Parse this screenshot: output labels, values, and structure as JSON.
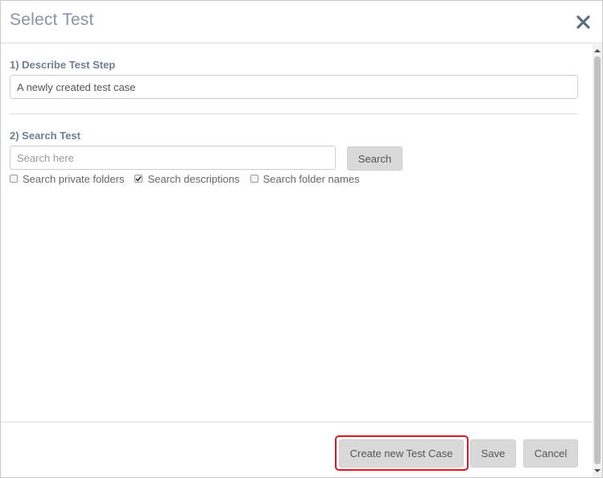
{
  "dialog": {
    "title": "Select Test",
    "close_icon": "close-x-icon"
  },
  "step1": {
    "label": "1) Describe Test Step",
    "value": "A newly created test case"
  },
  "step2": {
    "label": "2) Search Test",
    "search_placeholder": "Search here",
    "search_button": "Search",
    "options": [
      {
        "label": "Search private folders",
        "checked": false
      },
      {
        "label": "Search descriptions",
        "checked": true
      },
      {
        "label": "Search folder names",
        "checked": false
      }
    ]
  },
  "footer": {
    "create_button": "Create new Test Case",
    "save_button": "Save",
    "cancel_button": "Cancel",
    "highlight_color": "#e0161d"
  },
  "colors": {
    "title": "#8a94a4",
    "label": "#6f7f91",
    "button_bg": "#d9d9d9"
  }
}
